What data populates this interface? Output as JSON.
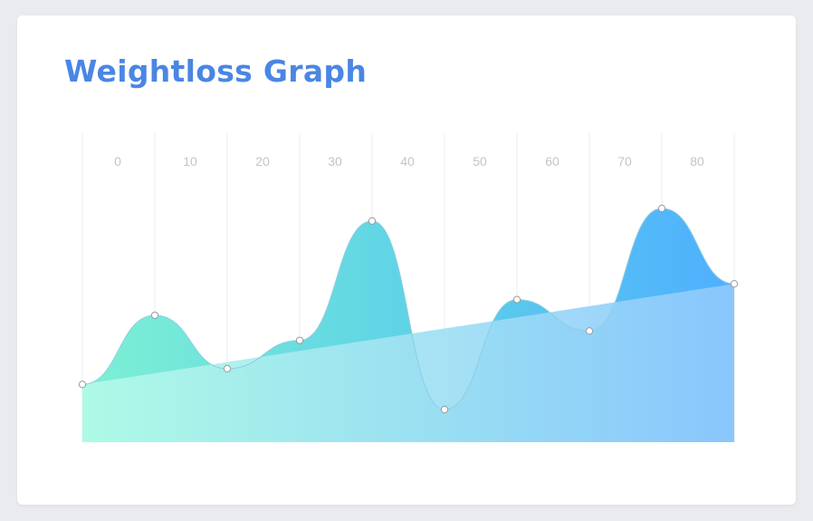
{
  "title": "Weightloss Graph",
  "colors": {
    "title": "#4a86e3",
    "gridline": "#ececec",
    "tick_label": "#c4c4c4",
    "peaks_start": "#7df0d4",
    "peaks_mid": "#5fd3e6",
    "peaks_end": "#4eafff",
    "base_start": "#b2fbe8",
    "base_end": "#8ec8fd",
    "point_fill": "#ffffff",
    "point_stroke": "#9a9a9a"
  },
  "chart_data": {
    "type": "area",
    "title": "Weightloss Graph",
    "xlabel": "",
    "ylabel": "",
    "x_ticks": [
      0,
      10,
      20,
      30,
      40,
      50,
      60,
      70,
      80
    ],
    "xlim": [
      0,
      90
    ],
    "ylim": [
      0,
      100
    ],
    "grid": true,
    "series": [
      {
        "x": [
          0,
          10,
          20,
          30,
          40,
          50,
          60,
          70,
          80,
          90
        ],
        "values": [
          19,
          41,
          24,
          33,
          71,
          11,
          46,
          36,
          75,
          51
        ]
      },
      {
        "x": [
          0,
          90
        ],
        "values": [
          19,
          51
        ]
      }
    ]
  }
}
